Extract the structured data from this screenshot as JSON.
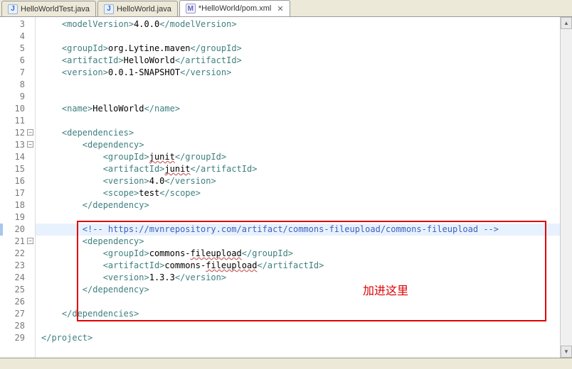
{
  "tabs": [
    {
      "label": "HelloWorldTest.java",
      "icon": "J",
      "active": false
    },
    {
      "label": "HelloWorld.java",
      "icon": "J",
      "active": false
    },
    {
      "label": "*HelloWorld/pom.xml",
      "icon": "M",
      "active": true
    }
  ],
  "annotation": "加进这里",
  "lines": [
    {
      "n": 3,
      "ind": 1,
      "parts": [
        [
          "tag",
          "<modelVersion>"
        ],
        [
          "txt",
          "4.0.0"
        ],
        [
          "tag",
          "</modelVersion>"
        ]
      ]
    },
    {
      "n": 4,
      "ind": 0,
      "parts": []
    },
    {
      "n": 5,
      "ind": 1,
      "parts": [
        [
          "tag",
          "<groupId>"
        ],
        [
          "txt",
          "org.Lytine.maven"
        ],
        [
          "tag",
          "</groupId>"
        ]
      ]
    },
    {
      "n": 6,
      "ind": 1,
      "parts": [
        [
          "tag",
          "<artifactId>"
        ],
        [
          "txt",
          "HelloWorld"
        ],
        [
          "tag",
          "</artifactId>"
        ]
      ]
    },
    {
      "n": 7,
      "ind": 1,
      "parts": [
        [
          "tag",
          "<version>"
        ],
        [
          "txt",
          "0.0.1-SNAPSHOT"
        ],
        [
          "tag",
          "</version>"
        ]
      ]
    },
    {
      "n": 8,
      "ind": 0,
      "parts": []
    },
    {
      "n": 9,
      "ind": 0,
      "parts": []
    },
    {
      "n": 10,
      "ind": 1,
      "parts": [
        [
          "tag",
          "<name>"
        ],
        [
          "txt",
          "HelloWorld"
        ],
        [
          "tag",
          "</name>"
        ]
      ]
    },
    {
      "n": 11,
      "ind": 0,
      "parts": []
    },
    {
      "n": 12,
      "ind": 1,
      "fold": "-",
      "parts": [
        [
          "tag",
          "<dependencies>"
        ]
      ]
    },
    {
      "n": 13,
      "ind": 2,
      "fold": "-",
      "parts": [
        [
          "tag",
          "<dependency>"
        ]
      ]
    },
    {
      "n": 14,
      "ind": 3,
      "parts": [
        [
          "tag",
          "<groupId>"
        ],
        [
          "wavy",
          "junit"
        ],
        [
          "tag",
          "</groupId>"
        ]
      ]
    },
    {
      "n": 15,
      "ind": 3,
      "parts": [
        [
          "tag",
          "<artifactId>"
        ],
        [
          "wavy",
          "junit"
        ],
        [
          "tag",
          "</artifactId>"
        ]
      ]
    },
    {
      "n": 16,
      "ind": 3,
      "parts": [
        [
          "tag",
          "<version>"
        ],
        [
          "txt",
          "4.0"
        ],
        [
          "tag",
          "</version>"
        ]
      ]
    },
    {
      "n": 17,
      "ind": 3,
      "parts": [
        [
          "tag",
          "<scope>"
        ],
        [
          "txt",
          "test"
        ],
        [
          "tag",
          "</scope>"
        ]
      ]
    },
    {
      "n": 18,
      "ind": 2,
      "parts": [
        [
          "tag",
          "</dependency>"
        ]
      ]
    },
    {
      "n": 19,
      "ind": 0,
      "parts": []
    },
    {
      "n": 20,
      "ind": 2,
      "hl": true,
      "caret": true,
      "parts": [
        [
          "comment",
          "<!-- https://mvnrepository.com/artifact/commons-fileupload/commons-fileupload -->"
        ]
      ]
    },
    {
      "n": 21,
      "ind": 2,
      "fold": "-",
      "parts": [
        [
          "tag",
          "<dependency>"
        ]
      ]
    },
    {
      "n": 22,
      "ind": 3,
      "parts": [
        [
          "tag",
          "<groupId>"
        ],
        [
          "txt",
          "commons-"
        ],
        [
          "wavy",
          "fileupload"
        ],
        [
          "tag",
          "</groupId>"
        ]
      ]
    },
    {
      "n": 23,
      "ind": 3,
      "parts": [
        [
          "tag",
          "<artifactId>"
        ],
        [
          "txt",
          "commons-"
        ],
        [
          "wavy",
          "fileupload"
        ],
        [
          "tag",
          "</artifactId>"
        ]
      ]
    },
    {
      "n": 24,
      "ind": 3,
      "parts": [
        [
          "tag",
          "<version>"
        ],
        [
          "txt",
          "1.3.3"
        ],
        [
          "tag",
          "</version>"
        ]
      ]
    },
    {
      "n": 25,
      "ind": 2,
      "parts": [
        [
          "tag",
          "</dependency>"
        ]
      ]
    },
    {
      "n": 26,
      "ind": 0,
      "parts": []
    },
    {
      "n": 27,
      "ind": 1,
      "parts": [
        [
          "tag",
          "</dependencies>"
        ]
      ]
    },
    {
      "n": 28,
      "ind": 0,
      "parts": []
    },
    {
      "n": 29,
      "ind": 0,
      "parts": [
        [
          "tag",
          "</project>"
        ]
      ]
    }
  ],
  "redbox": {
    "top_line_index": 17,
    "height_lines": 8
  }
}
